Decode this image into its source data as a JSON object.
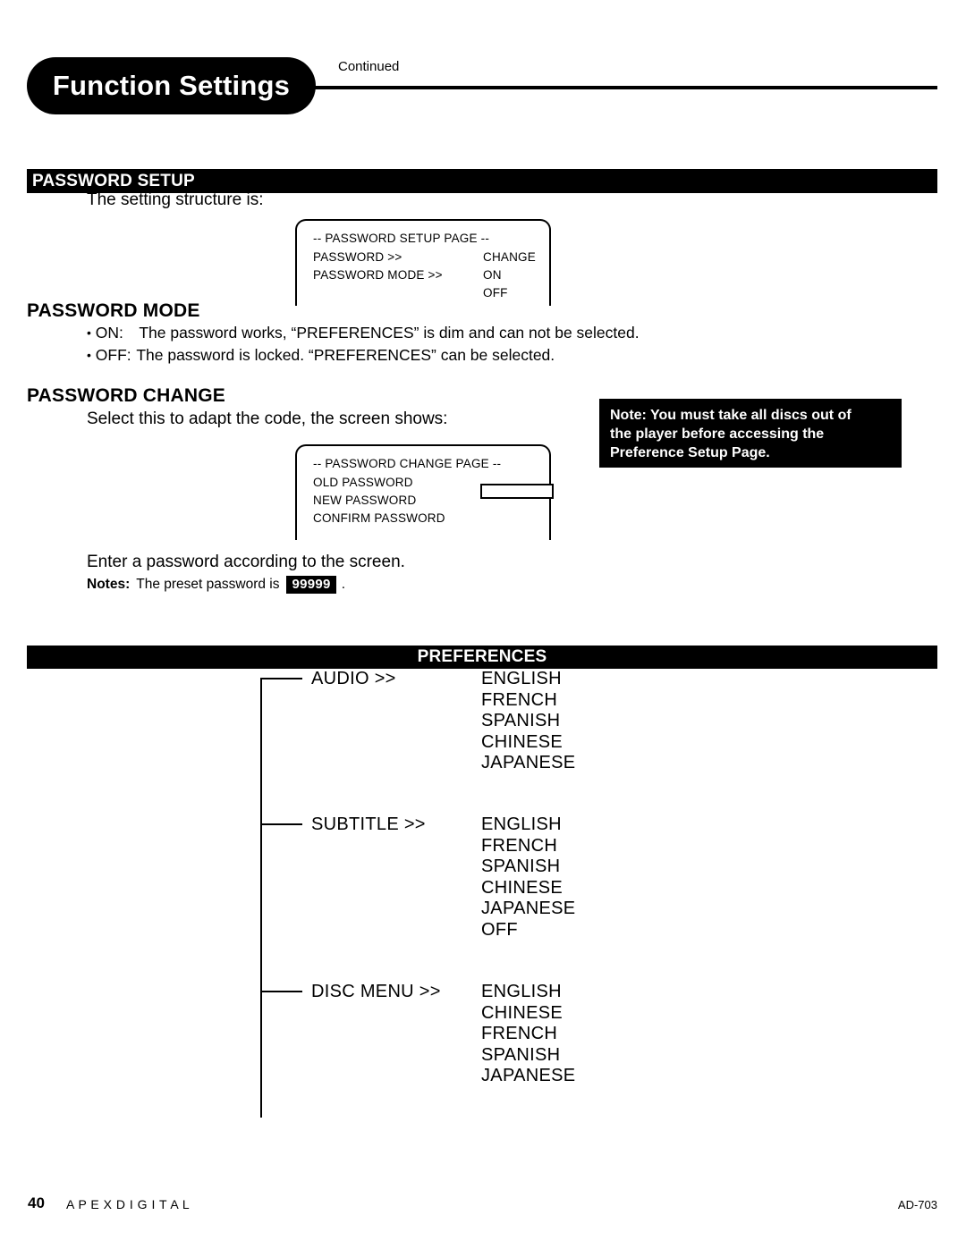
{
  "header": {
    "title": "Function Settings",
    "continued": "Continued"
  },
  "password_setup": {
    "bar_label": "PASSWORD SETUP",
    "intro": "The setting structure is:",
    "osd": {
      "title": "-- PASSWORD SETUP PAGE --",
      "rows": [
        {
          "left": "PASSWORD >>",
          "right": "CHANGE"
        },
        {
          "left": "PASSWORD MODE >>",
          "right": "ON"
        },
        {
          "left": "",
          "right": "OFF"
        }
      ]
    }
  },
  "password_mode": {
    "heading": "PASSWORD MODE",
    "bullets": [
      {
        "key": "ON:",
        "text": "The password works, “PREFERENCES” is dim and can not be selected."
      },
      {
        "key": "OFF:",
        "text": "The password is locked.  “PREFERENCES” can be selected."
      }
    ]
  },
  "password_change": {
    "heading": "PASSWORD CHANGE",
    "intro": "Select this to adapt the code, the screen shows:",
    "osd": {
      "title": "-- PASSWORD CHANGE PAGE --",
      "rows": [
        {
          "left": "OLD PASSWORD"
        },
        {
          "left": "NEW PASSWORD"
        },
        {
          "left": "CONFIRM PASSWORD"
        }
      ],
      "input_value": ""
    },
    "enter_text": "Enter a password according to the screen.",
    "notes_label": "Notes:",
    "notes_text": "The preset password is",
    "preset_password": "99999",
    "notes_period": "."
  },
  "note_callout": {
    "lines": [
      "Note: You must take all discs out of",
      "the player before accessing the",
      "Preference Setup Page."
    ]
  },
  "preferences": {
    "bar_label": "PREFERENCES",
    "nodes": [
      {
        "label": "AUDIO >>",
        "options": [
          "ENGLISH",
          "FRENCH",
          "SPANISH",
          "CHINESE",
          "JAPANESE"
        ]
      },
      {
        "label": "SUBTITLE >>",
        "options": [
          "ENGLISH",
          "FRENCH",
          "SPANISH",
          "CHINESE",
          "JAPANESE",
          "OFF"
        ]
      },
      {
        "label": "DISC MENU >>",
        "options": [
          "ENGLISH",
          "CHINESE",
          "FRENCH",
          "SPANISH",
          "JAPANESE"
        ]
      }
    ]
  },
  "footer": {
    "page_number": "40",
    "brand": "A P E X    D I G I T A L",
    "model": "AD-703"
  }
}
